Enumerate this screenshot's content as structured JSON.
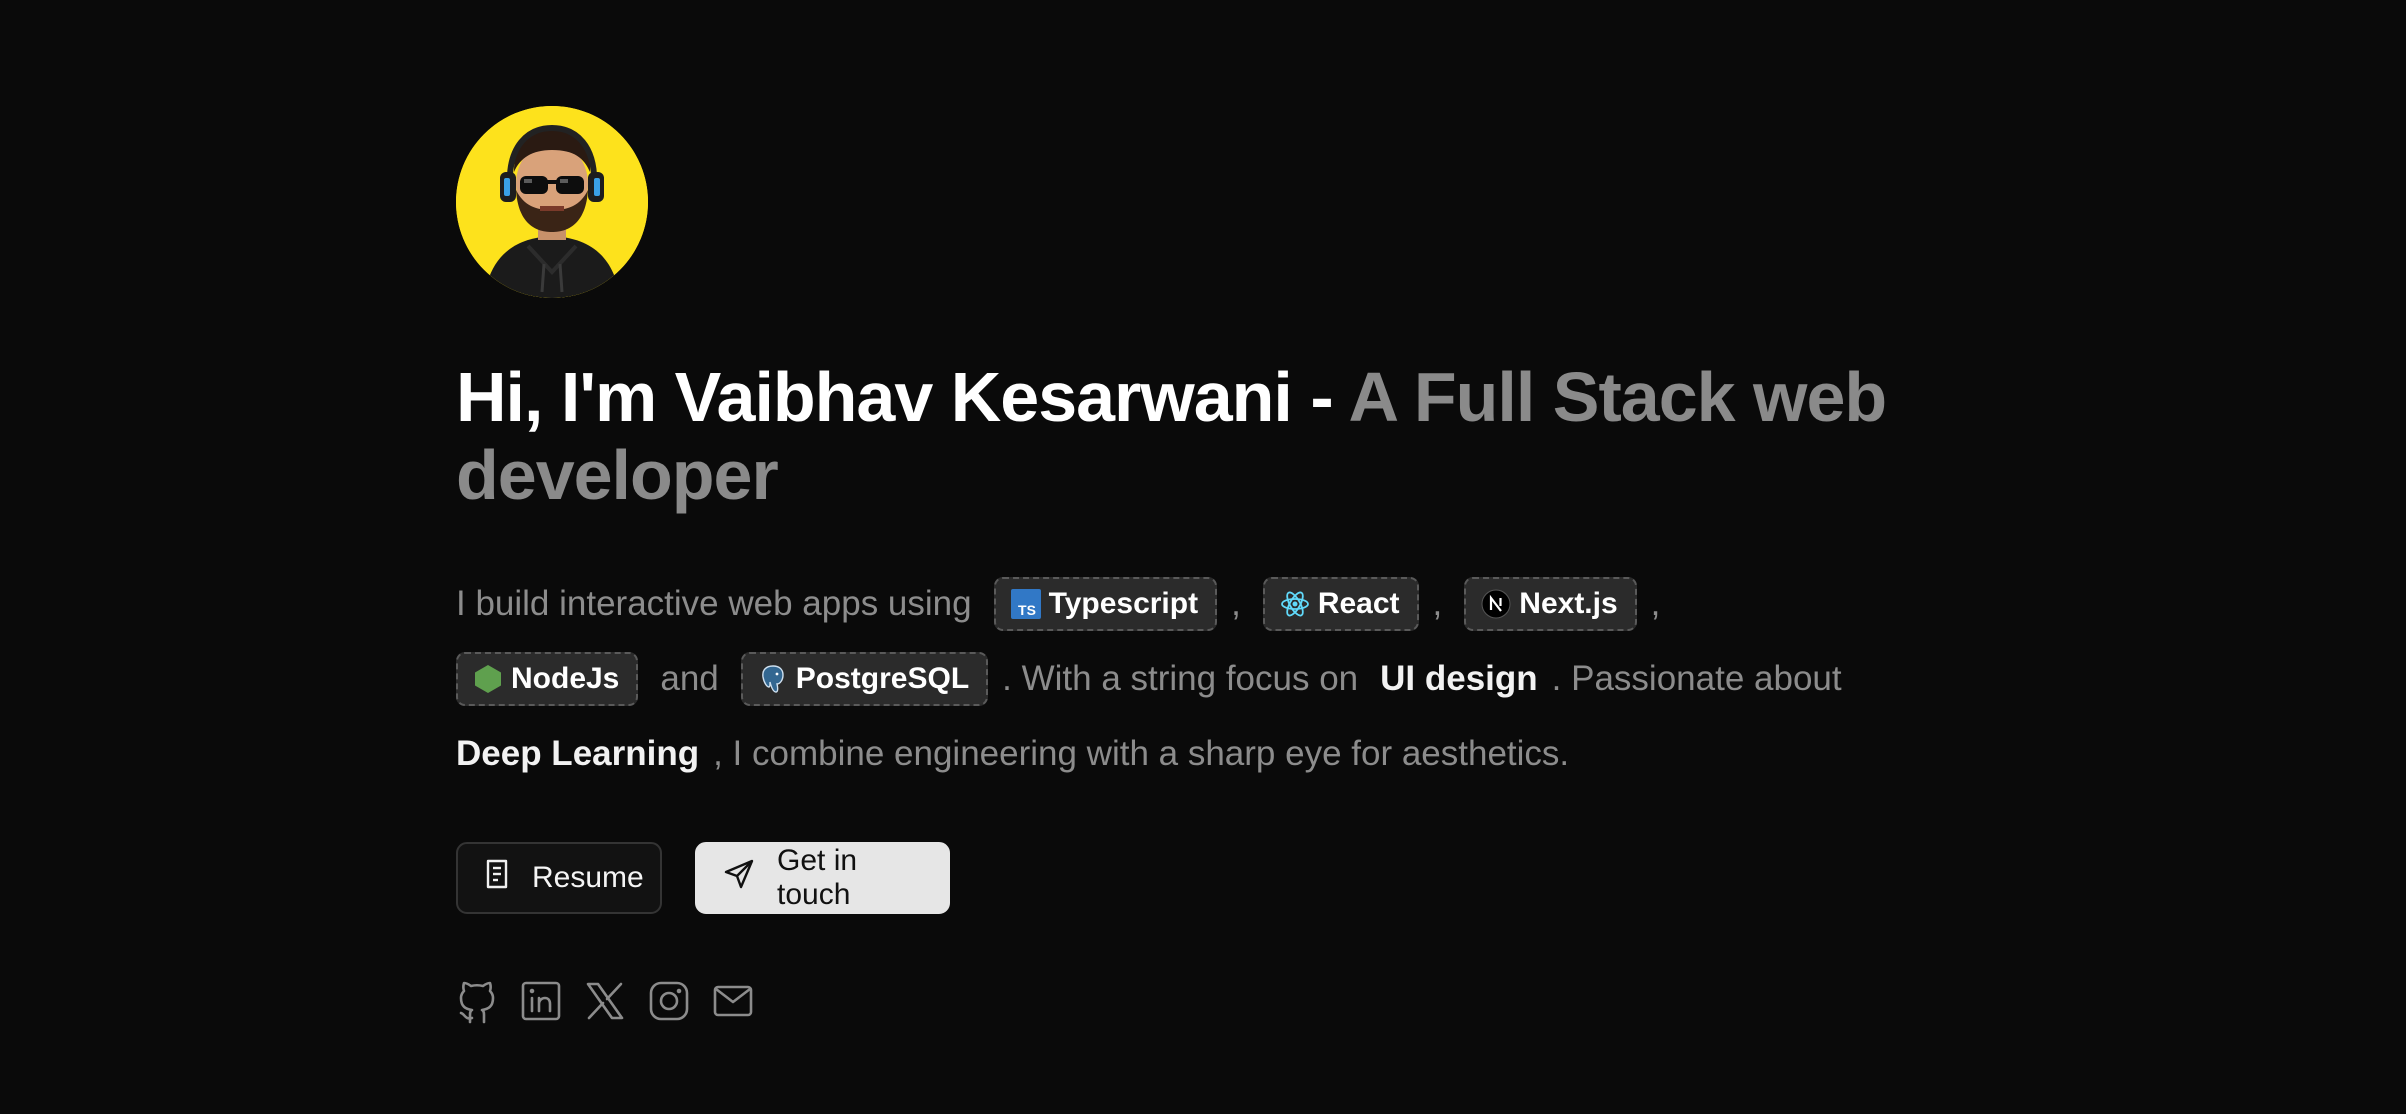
{
  "profile": {
    "avatar_alt": "Vaibhav Kesarwani avatar"
  },
  "heading": {
    "name_part": "Hi, I'm Vaibhav Kesarwani - ",
    "role_part": "A Full Stack web developer"
  },
  "about": {
    "intro": "I build interactive web apps using",
    "comma": ",",
    "and": "and",
    "focus_prefix": ". With a string focus on",
    "focus_highlight": "UI design",
    "passion_prefix": ". Passionate about",
    "passion_highlight": "Deep Learning",
    "outro": ", I combine engineering with a sharp eye for aesthetics.",
    "tech": [
      {
        "label": "Typescript",
        "icon": "typescript-icon"
      },
      {
        "label": "React",
        "icon": "react-icon"
      },
      {
        "label": "Next.js",
        "icon": "nextjs-icon"
      },
      {
        "label": "NodeJs",
        "icon": "nodejs-icon"
      },
      {
        "label": "PostgreSQL",
        "icon": "postgresql-icon"
      }
    ]
  },
  "actions": {
    "resume_label": "Resume",
    "contact_label": "Get in touch"
  },
  "socials": [
    {
      "icon": "github-icon"
    },
    {
      "icon": "linkedin-icon"
    },
    {
      "icon": "x-icon"
    },
    {
      "icon": "instagram-icon"
    },
    {
      "icon": "mail-icon"
    }
  ],
  "colors": {
    "background": "#0a0a0a",
    "avatar_bg": "#fde21c",
    "muted_text": "#8c8c8c",
    "chip_bg": "#2b2b2b",
    "button_light": "#e6e6e6"
  }
}
